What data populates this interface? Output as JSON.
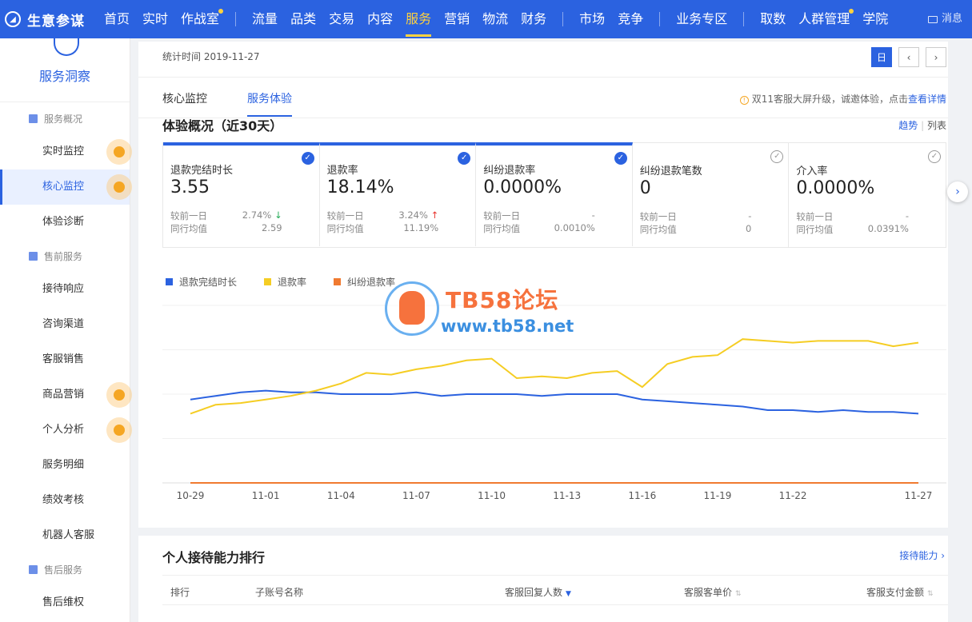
{
  "app": {
    "name": "生意参谋",
    "message_label": "消息"
  },
  "nav": {
    "groups": [
      [
        {
          "label": "首页"
        },
        {
          "label": "实时"
        },
        {
          "label": "作战室",
          "dot": true
        }
      ],
      [
        {
          "label": "流量"
        },
        {
          "label": "品类"
        },
        {
          "label": "交易"
        },
        {
          "label": "内容"
        },
        {
          "label": "服务",
          "active": true
        },
        {
          "label": "营销"
        },
        {
          "label": "物流"
        },
        {
          "label": "财务"
        }
      ],
      [
        {
          "label": "市场"
        },
        {
          "label": "竞争"
        }
      ],
      [
        {
          "label": "业务专区"
        }
      ],
      [
        {
          "label": "取数"
        },
        {
          "label": "人群管理",
          "dot": true
        },
        {
          "label": "学院"
        }
      ]
    ]
  },
  "sidebar": {
    "title": "服务洞察",
    "sections": [
      {
        "label": "服务概况",
        "items": [
          {
            "label": "实时监控",
            "highlight": true
          },
          {
            "label": "核心监控",
            "active": true,
            "highlight": true
          },
          {
            "label": "体验诊断"
          }
        ]
      },
      {
        "label": "售前服务",
        "items": [
          {
            "label": "接待响应"
          },
          {
            "label": "咨询渠道"
          },
          {
            "label": "客服销售"
          },
          {
            "label": "商品营销",
            "highlight": true
          },
          {
            "label": "个人分析",
            "highlight": true
          },
          {
            "label": "服务明细"
          },
          {
            "label": "绩效考核"
          },
          {
            "label": "机器人客服"
          }
        ]
      },
      {
        "label": "售后服务",
        "items": [
          {
            "label": "售后维权"
          }
        ]
      }
    ]
  },
  "header": {
    "stat_time": "统计时间 2019-11-27",
    "date_buttons": [
      "日",
      "‹",
      "›"
    ]
  },
  "tabs": [
    {
      "label": "核心监控"
    },
    {
      "label": "服务体验",
      "active": true
    }
  ],
  "notice": {
    "text": "双11客服大屏升级，诚邀体验，点击",
    "link": "查看详情"
  },
  "section": {
    "title": "体验概况（近30天）",
    "view_trend": "趋势",
    "view_list": "列表"
  },
  "metrics": [
    {
      "name": "退款完结时长",
      "value": "3.55",
      "cmp_label": "较前一日",
      "cmp_value": "2.74%",
      "trend": "down",
      "avg_label": "同行均值",
      "avg_value": "2.59",
      "checked": true
    },
    {
      "name": "退款率",
      "value": "18.14%",
      "cmp_label": "较前一日",
      "cmp_value": "3.24%",
      "trend": "up",
      "avg_label": "同行均值",
      "avg_value": "11.19%",
      "checked": true
    },
    {
      "name": "纠纷退款率",
      "value": "0.0000%",
      "cmp_label": "较前一日",
      "cmp_value": "-",
      "trend": "",
      "avg_label": "同行均值",
      "avg_value": "0.0010%",
      "checked": true
    },
    {
      "name": "纠纷退款笔数",
      "value": "0",
      "cmp_label": "较前一日",
      "cmp_value": "-",
      "trend": "",
      "avg_label": "同行均值",
      "avg_value": "0",
      "checked": false
    },
    {
      "name": "介入率",
      "value": "0.0000%",
      "cmp_label": "较前一日",
      "cmp_value": "-",
      "trend": "",
      "avg_label": "同行均值",
      "avg_value": "0.0391%",
      "checked": false
    }
  ],
  "watermark": {
    "line1": "TB58论坛",
    "line2": "www.tb58.net"
  },
  "colors": {
    "brand": "#2b62e0",
    "series": [
      "#2b62e0",
      "#f5cd23",
      "#f07a30"
    ]
  },
  "chart_data": {
    "type": "line",
    "x": [
      "10-29",
      "10-30",
      "10-31",
      "11-01",
      "11-02",
      "11-03",
      "11-04",
      "11-05",
      "11-06",
      "11-07",
      "11-08",
      "11-09",
      "11-10",
      "11-11",
      "11-12",
      "11-13",
      "11-14",
      "11-15",
      "11-16",
      "11-17",
      "11-18",
      "11-19",
      "11-20",
      "11-21",
      "11-22",
      "11-23",
      "11-24",
      "11-25",
      "11-26",
      "11-27"
    ],
    "x_tick_labels": [
      "10-29",
      "11-01",
      "11-04",
      "11-07",
      "11-10",
      "11-13",
      "11-16",
      "11-19",
      "11-22",
      "11-27"
    ],
    "series": [
      {
        "name": "退款完结时长",
        "values": [
          47,
          49,
          51,
          52,
          51,
          51,
          50,
          50,
          50,
          51,
          49,
          50,
          50,
          50,
          49,
          50,
          50,
          50,
          47,
          46,
          45,
          44,
          43,
          41,
          41,
          40,
          41,
          40,
          40,
          39
        ]
      },
      {
        "name": "退款率",
        "values": [
          39,
          44,
          45,
          47,
          49,
          52,
          56,
          62,
          61,
          64,
          66,
          69,
          70,
          59,
          60,
          59,
          62,
          63,
          54,
          67,
          71,
          72,
          81,
          80,
          79,
          80,
          80,
          80,
          77,
          79
        ]
      },
      {
        "name": "纠纷退款率",
        "values": [
          0,
          0,
          0,
          0,
          0,
          0,
          0,
          0,
          0,
          0,
          0,
          0,
          0,
          0,
          0,
          0,
          0,
          0,
          0,
          0,
          0,
          0,
          0,
          0,
          0,
          0,
          0,
          0,
          0,
          0
        ]
      }
    ],
    "ylim": [
      0,
      100
    ],
    "grid": true,
    "legend": "top-left"
  },
  "ranking": {
    "title": "个人接待能力排行",
    "link": "接待能力",
    "columns": [
      {
        "label": "排行"
      },
      {
        "label": "子账号名称"
      },
      {
        "label": "客服回复人数",
        "sort": "active"
      },
      {
        "label": "客服客单价",
        "sort": "both"
      },
      {
        "label": "客服支付金额",
        "sort": "both"
      }
    ]
  }
}
